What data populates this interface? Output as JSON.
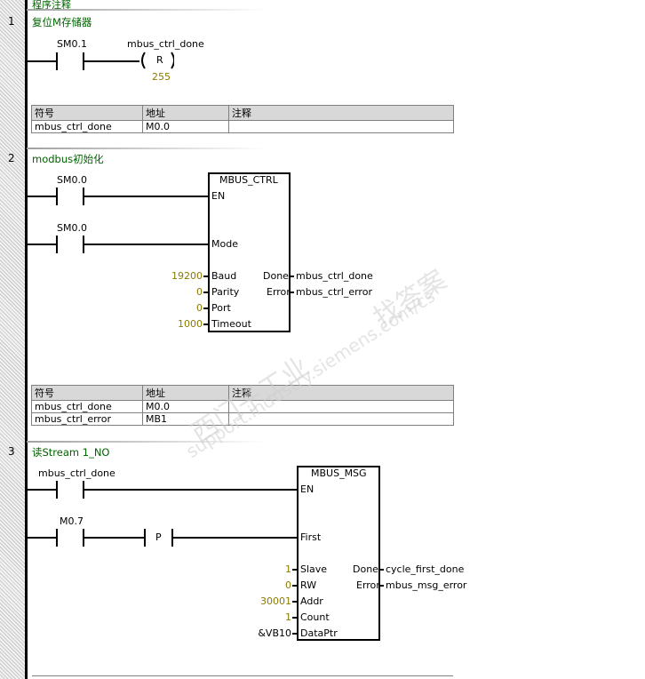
{
  "header": {
    "title": "程序注释"
  },
  "networks": [
    {
      "number": "1",
      "comment": "复位M存储器",
      "contact": "SM0.1",
      "coil_operand": "mbus_ctrl_done",
      "coil_type": "R",
      "coil_count": "255",
      "table": {
        "headers": [
          "符号",
          "地址",
          "注释"
        ],
        "rows": [
          [
            "mbus_ctrl_done",
            "M0.0",
            ""
          ]
        ]
      }
    },
    {
      "number": "2",
      "comment": "modbus初始化",
      "contact1": "SM0.0",
      "contact2": "SM0.0",
      "block": {
        "name": "MBUS_CTRL",
        "in": [
          "EN",
          "Mode",
          "Baud",
          "Parity",
          "Port",
          "Timeout"
        ],
        "out": [
          "Done",
          "Error"
        ]
      },
      "inputs": {
        "baud": "19200",
        "parity": "0",
        "port": "0",
        "timeout": "1000"
      },
      "outputs": {
        "done": "mbus_ctrl_done",
        "error": "mbus_ctrl_error"
      },
      "table": {
        "headers": [
          "符号",
          "地址",
          "注释"
        ],
        "rows": [
          [
            "mbus_ctrl_done",
            "M0.0",
            ""
          ],
          [
            "mbus_ctrl_error",
            "MB1",
            ""
          ]
        ]
      }
    },
    {
      "number": "3",
      "comment": "读Stream 1_NO",
      "contact1": "mbus_ctrl_done",
      "contact2": "M0.7",
      "edge": "P",
      "block": {
        "name": "MBUS_MSG",
        "in": [
          "EN",
          "First",
          "Slave",
          "RW",
          "Addr",
          "Count",
          "DataPtr"
        ],
        "out": [
          "Done",
          "Error"
        ]
      },
      "inputs": {
        "slave": "1",
        "rw": "0",
        "addr": "30001",
        "count": "1",
        "dataptr": "&VB10"
      },
      "outputs": {
        "done": "cycle_first_done",
        "error": "mbus_msg_error"
      }
    }
  ],
  "watermark": {
    "text1": "西门子工业",
    "text2": "support.industry.siemens.com/cs",
    "text3": "找答案"
  }
}
